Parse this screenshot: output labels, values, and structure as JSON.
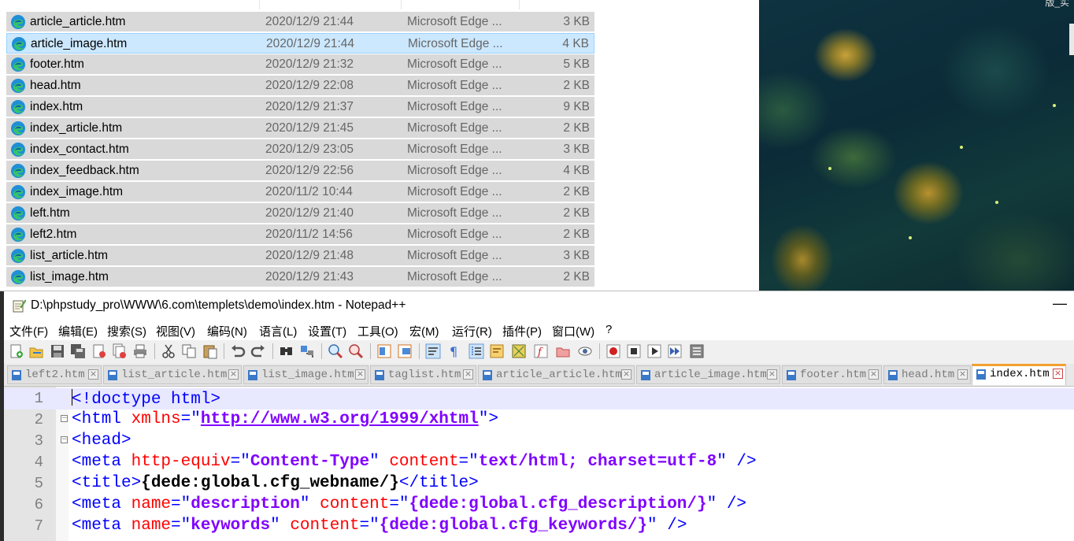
{
  "explorer": {
    "files": [
      {
        "name": "article_article.htm",
        "date": "2020/12/9 21:44",
        "type": "Microsoft Edge ...",
        "size": "3 KB"
      },
      {
        "name": "article_image.htm",
        "date": "2020/12/9 21:44",
        "type": "Microsoft Edge ...",
        "size": "4 KB",
        "selected": true
      },
      {
        "name": "footer.htm",
        "date": "2020/12/9 21:32",
        "type": "Microsoft Edge ...",
        "size": "5 KB"
      },
      {
        "name": "head.htm",
        "date": "2020/12/9 22:08",
        "type": "Microsoft Edge ...",
        "size": "2 KB"
      },
      {
        "name": "index.htm",
        "date": "2020/12/9 21:37",
        "type": "Microsoft Edge ...",
        "size": "9 KB"
      },
      {
        "name": "index_article.htm",
        "date": "2020/12/9 21:45",
        "type": "Microsoft Edge ...",
        "size": "2 KB"
      },
      {
        "name": "index_contact.htm",
        "date": "2020/12/9 23:05",
        "type": "Microsoft Edge ...",
        "size": "3 KB"
      },
      {
        "name": "index_feedback.htm",
        "date": "2020/12/9 22:56",
        "type": "Microsoft Edge ...",
        "size": "4 KB"
      },
      {
        "name": "index_image.htm",
        "date": "2020/11/2 10:44",
        "type": "Microsoft Edge ...",
        "size": "2 KB"
      },
      {
        "name": "left.htm",
        "date": "2020/12/9 21:40",
        "type": "Microsoft Edge ...",
        "size": "2 KB"
      },
      {
        "name": "left2.htm",
        "date": "2020/11/2 14:56",
        "type": "Microsoft Edge ...",
        "size": "2 KB"
      },
      {
        "name": "list_article.htm",
        "date": "2020/12/9 21:48",
        "type": "Microsoft Edge ...",
        "size": "3 KB"
      },
      {
        "name": "list_image.htm",
        "date": "2020/12/9 21:43",
        "type": "Microsoft Edge ...",
        "size": "2 KB"
      }
    ],
    "file_icon": "microsoft-edge-icon"
  },
  "wallpaper": {
    "corner_text": "版_实"
  },
  "notepad": {
    "title": "D:\\phpstudy_pro\\WWW\\6.com\\templets\\demo\\index.htm - Notepad++",
    "minimize_label": "—",
    "menu": [
      "文件(F)",
      "编辑(E)",
      "搜索(S)",
      "视图(V)",
      "编码(N)",
      "语言(L)",
      "设置(T)",
      "工具(O)",
      "宏(M)",
      "运行(R)",
      "插件(P)",
      "窗口(W)",
      "?"
    ],
    "toolbar_icons": [
      "new-file-icon",
      "open-file-icon",
      "save-icon",
      "save-all-icon",
      "close-icon",
      "close-all-icon",
      "print-icon",
      "cut-icon",
      "copy-icon",
      "paste-icon",
      "undo-icon",
      "redo-icon",
      "find-icon",
      "replace-icon",
      "zoom-in-icon",
      "zoom-out-icon",
      "sync-vertical-icon",
      "sync-horizontal-icon",
      "word-wrap-icon",
      "show-all-chars-icon",
      "indent-guide-icon",
      "user-lang-icon",
      "doc-map-icon",
      "function-list-icon",
      "folder-workspace-icon",
      "monitor-icon",
      "record-macro-icon",
      "stop-macro-icon",
      "play-macro-icon",
      "run-macro-multiple-icon",
      "save-macro-icon"
    ],
    "tabs": [
      {
        "label": "left2.htm"
      },
      {
        "label": "list_article.htm"
      },
      {
        "label": "list_image.htm"
      },
      {
        "label": "taglist.htm"
      },
      {
        "label": "article_article.htm"
      },
      {
        "label": "article_image.htm"
      },
      {
        "label": "footer.htm"
      },
      {
        "label": "head.htm"
      },
      {
        "label": "index.htm",
        "active": true
      }
    ],
    "close_glyph": "×",
    "fold_glyph": "−",
    "lines": [
      {
        "n": "1",
        "tokens": [
          {
            "t": "<!doctype html>",
            "c": "t-blue"
          }
        ],
        "current": true
      },
      {
        "n": "2",
        "fold": true,
        "tokens": [
          {
            "t": "<html ",
            "c": "t-blue"
          },
          {
            "t": "xmlns",
            "c": "t-red"
          },
          {
            "t": "=\"",
            "c": "t-blue"
          },
          {
            "t": "http://www.w3.org/1999/xhtml",
            "c": "t-link"
          },
          {
            "t": "\">",
            "c": "t-blue"
          }
        ]
      },
      {
        "n": "3",
        "fold": true,
        "tokens": [
          {
            "t": "<head>",
            "c": "t-blue"
          }
        ]
      },
      {
        "n": "4",
        "tokens": [
          {
            "t": "<meta ",
            "c": "t-blue"
          },
          {
            "t": "http-equiv",
            "c": "t-red"
          },
          {
            "t": "=\"",
            "c": "t-blue"
          },
          {
            "t": "Content-Type",
            "c": "t-val"
          },
          {
            "t": "\" ",
            "c": "t-blue"
          },
          {
            "t": "content",
            "c": "t-red"
          },
          {
            "t": "=\"",
            "c": "t-blue"
          },
          {
            "t": "text/html; charset=utf-8",
            "c": "t-val"
          },
          {
            "t": "\" />",
            "c": "t-blue"
          }
        ]
      },
      {
        "n": "5",
        "tokens": [
          {
            "t": "<title>",
            "c": "t-blue"
          },
          {
            "t": "{dede:global.cfg_webname/}",
            "c": "t-black"
          },
          {
            "t": "</title>",
            "c": "t-blue"
          }
        ]
      },
      {
        "n": "6",
        "tokens": [
          {
            "t": "<meta ",
            "c": "t-blue"
          },
          {
            "t": "name",
            "c": "t-red"
          },
          {
            "t": "=\"",
            "c": "t-blue"
          },
          {
            "t": "description",
            "c": "t-val"
          },
          {
            "t": "\" ",
            "c": "t-blue"
          },
          {
            "t": "content",
            "c": "t-red"
          },
          {
            "t": "=\"",
            "c": "t-blue"
          },
          {
            "t": "{dede:global.cfg_description/}",
            "c": "t-val"
          },
          {
            "t": "\" />",
            "c": "t-blue"
          }
        ]
      },
      {
        "n": "7",
        "tokens": [
          {
            "t": "<meta ",
            "c": "t-blue"
          },
          {
            "t": "name",
            "c": "t-red"
          },
          {
            "t": "=\"",
            "c": "t-blue"
          },
          {
            "t": "keywords",
            "c": "t-val"
          },
          {
            "t": "\" ",
            "c": "t-blue"
          },
          {
            "t": "content",
            "c": "t-red"
          },
          {
            "t": "=\"",
            "c": "t-blue"
          },
          {
            "t": "{dede:global.cfg_keywords/}",
            "c": "t-val"
          },
          {
            "t": "\" />",
            "c": "t-blue"
          }
        ]
      }
    ]
  }
}
